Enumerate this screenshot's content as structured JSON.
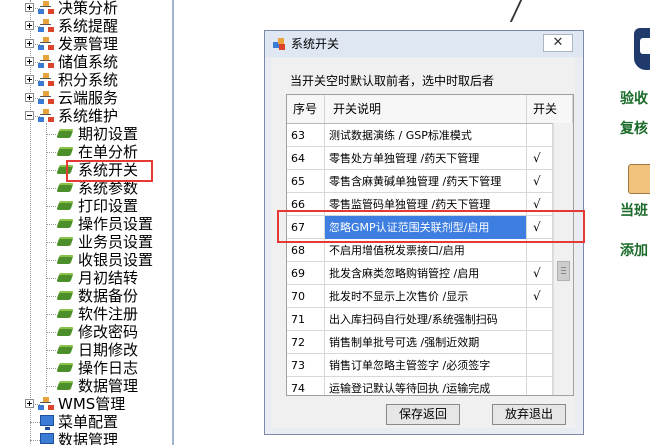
{
  "tree": {
    "items": [
      {
        "label": "决策分析",
        "icon": "org-chart-icon",
        "level": 1,
        "expander": "plus"
      },
      {
        "label": "系统提醒",
        "icon": "org-chart-icon",
        "level": 1,
        "expander": "plus"
      },
      {
        "label": "发票管理",
        "icon": "org-chart-icon",
        "level": 1,
        "expander": "plus"
      },
      {
        "label": "储值系统",
        "icon": "org-chart-icon",
        "level": 1,
        "expander": "plus"
      },
      {
        "label": "积分系统",
        "icon": "org-chart-icon",
        "level": 1,
        "expander": "plus"
      },
      {
        "label": "云端服务",
        "icon": "org-chart-icon",
        "level": 1,
        "expander": "plus"
      },
      {
        "label": "系统维护",
        "icon": "org-chart-icon",
        "level": 1,
        "expander": "minus"
      },
      {
        "label": "期初设置",
        "icon": "leaf-icon",
        "level": 2
      },
      {
        "label": "在单分析",
        "icon": "leaf-icon",
        "level": 2
      },
      {
        "label": "系统开关",
        "icon": "leaf-icon",
        "level": 2,
        "highlighted": true
      },
      {
        "label": "系统参数",
        "icon": "leaf-icon",
        "level": 2
      },
      {
        "label": "打印设置",
        "icon": "leaf-icon",
        "level": 2
      },
      {
        "label": "操作员设置",
        "icon": "leaf-icon",
        "level": 2
      },
      {
        "label": "业务员设置",
        "icon": "leaf-icon",
        "level": 2
      },
      {
        "label": "收银员设置",
        "icon": "leaf-icon",
        "level": 2
      },
      {
        "label": "月初结转",
        "icon": "leaf-icon",
        "level": 2
      },
      {
        "label": "数据备份",
        "icon": "leaf-icon",
        "level": 2
      },
      {
        "label": "软件注册",
        "icon": "leaf-icon",
        "level": 2
      },
      {
        "label": "修改密码",
        "icon": "leaf-icon",
        "level": 2
      },
      {
        "label": "日期修改",
        "icon": "leaf-icon",
        "level": 2
      },
      {
        "label": "操作日志",
        "icon": "leaf-icon",
        "level": 2
      },
      {
        "label": "数据管理",
        "icon": "leaf-icon",
        "level": 2
      },
      {
        "label": "WMS管理",
        "icon": "org-chart-icon",
        "level": 1,
        "expander": "plus"
      },
      {
        "label": "菜单配置",
        "icon": "monitor-icon",
        "level": 1
      },
      {
        "label": "数据管理",
        "icon": "monitor-icon",
        "level": 1
      }
    ]
  },
  "right_panel": {
    "links": [
      "验收",
      "复核",
      "当班",
      "添加"
    ]
  },
  "dialog": {
    "title": "系统开关",
    "close_glyph": "✕",
    "hint": "当开关空时默认取前者，选中时取后者",
    "columns": {
      "seq": "序号",
      "desc": "开关说明",
      "switch": "开关"
    },
    "rows": [
      {
        "seq": "63",
        "desc": "测试数据演练 / GSP标准模式",
        "switch": ""
      },
      {
        "seq": "64",
        "desc": "零售处方单独管理 /药天下管理",
        "switch": "√"
      },
      {
        "seq": "65",
        "desc": "零售含麻黄碱单独管理 /药天下管理",
        "switch": "√"
      },
      {
        "seq": "66",
        "desc": "零售监管码单独管理 /药天下管理",
        "switch": "√"
      },
      {
        "seq": "67",
        "desc": "忽略GMP认证范围关联剂型/启用",
        "switch": "√",
        "selected": true
      },
      {
        "seq": "68",
        "desc": "不启用增值税发票接口/启用",
        "switch": ""
      },
      {
        "seq": "69",
        "desc": "批发含麻类忽略购销管控 /启用",
        "switch": "√"
      },
      {
        "seq": "70",
        "desc": "批发时不显示上次售价 /显示",
        "switch": "√"
      },
      {
        "seq": "71",
        "desc": "出入库扫码自行处理/系统强制扫码",
        "switch": ""
      },
      {
        "seq": "72",
        "desc": "销售制单批号可选 /强制近效期",
        "switch": ""
      },
      {
        "seq": "73",
        "desc": "销售订单忽略主管签字 /必须签字",
        "switch": ""
      },
      {
        "seq": "74",
        "desc": "运输登记默认等待回执 /运输完成",
        "switch": ""
      }
    ],
    "buttons": {
      "save": "保存返回",
      "cancel": "放弃退出"
    }
  },
  "colors": {
    "selection": "#3d7ee0",
    "highlight_box": "#e53935",
    "link_green": "#1a6b2a"
  }
}
